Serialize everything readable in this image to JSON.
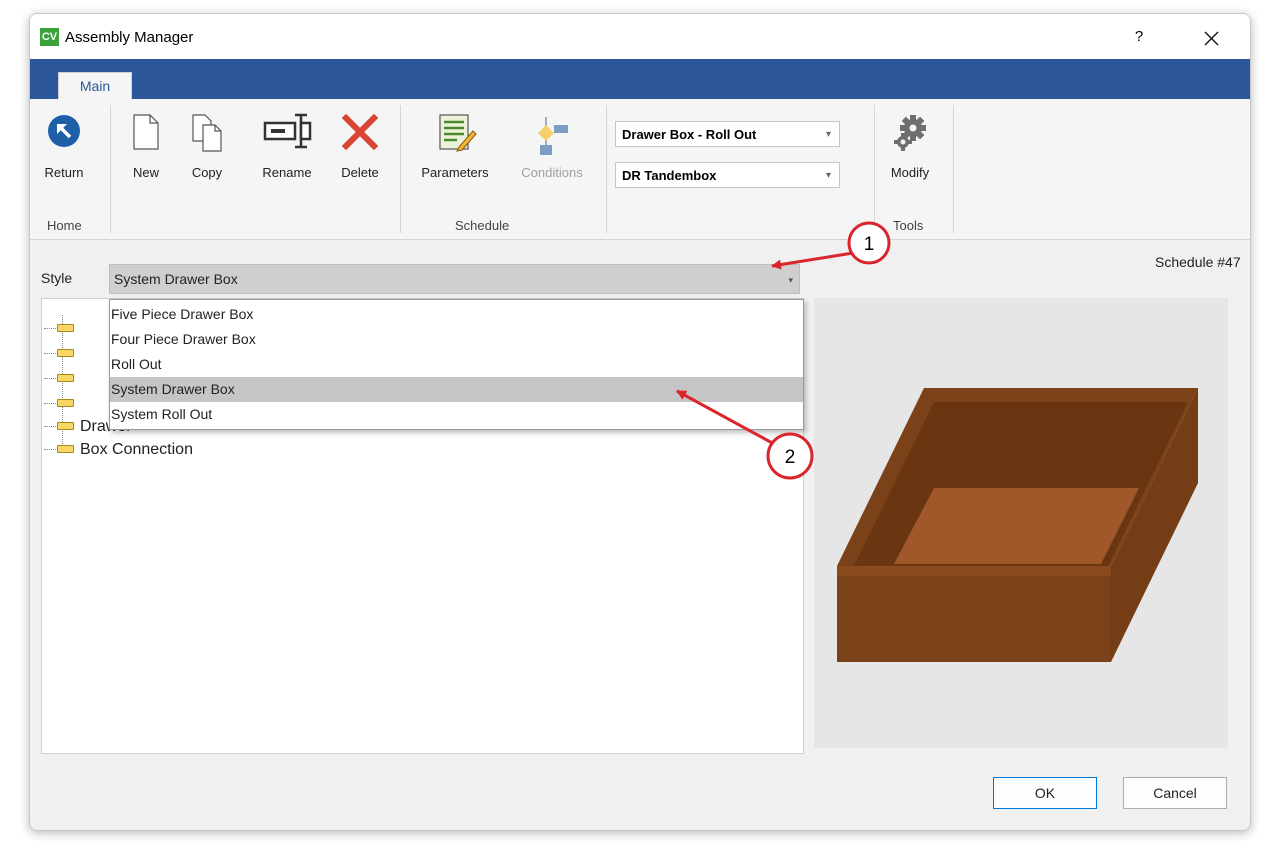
{
  "window": {
    "app_icon_text": "CV",
    "title": "Assembly Manager",
    "help_label": "?"
  },
  "ribbon": {
    "tab_main": "Main",
    "buttons": {
      "return": "Return",
      "new": "New",
      "copy": "Copy",
      "rename": "Rename",
      "delete": "Delete",
      "parameters": "Parameters",
      "conditions": "Conditions",
      "modify": "Modify"
    },
    "combo_type": "Drawer Box - Roll Out",
    "combo_schedule": "DR Tandembox",
    "groups": {
      "home": "Home",
      "schedule": "Schedule",
      "tools": "Tools"
    }
  },
  "schedule_number": "Schedule #47",
  "style": {
    "label": "Style",
    "selected": "System Drawer Box",
    "options": [
      "Five Piece Drawer Box",
      "Four Piece Drawer Box",
      "Roll Out",
      "System Drawer Box",
      "System Roll Out"
    ],
    "selected_index": 3
  },
  "tree": {
    "visible_items": [
      "Drawer",
      "Box Connection"
    ]
  },
  "callouts": [
    "1",
    "2"
  ],
  "footer": {
    "ok": "OK",
    "cancel": "Cancel"
  },
  "colors": {
    "ribbon_blue": "#2b579a",
    "callout_red": "#d9252b",
    "box_brown": "#7b4219",
    "box_floor": "#a0582a"
  }
}
